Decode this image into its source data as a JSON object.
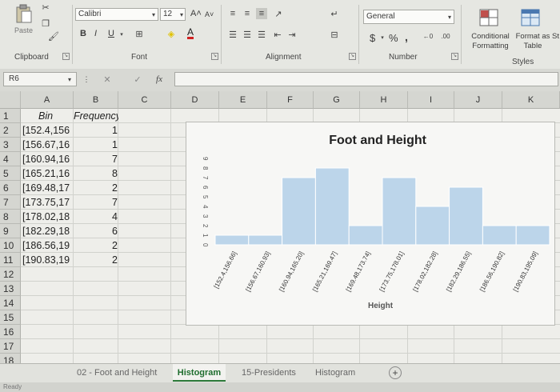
{
  "ribbon": {
    "paste_label": "Paste",
    "clipboard_label": "Clipboard",
    "font_label": "Font",
    "alignment_label": "Alignment",
    "number_label": "Number",
    "styles_label": "Styles",
    "font_name": "Calibri",
    "font_size": "12",
    "number_format": "General",
    "conditional_formatting": "Conditional Formatting",
    "format_as_table": "Format as Table",
    "cell_styles_partial": "St",
    "bold": "B",
    "italic": "I",
    "underline": "U",
    "currency": "$",
    "percent": "%",
    "comma": ",",
    "increase_font": "A˄",
    "decrease_font": "A˅",
    "font_color_letter": "A"
  },
  "formula_bar": {
    "name_box": "R6",
    "cancel": "✕",
    "enter": "✓",
    "fx": "fx",
    "formula": ""
  },
  "columns": [
    "A",
    "B",
    "C",
    "D",
    "E",
    "F",
    "G",
    "H",
    "I",
    "J",
    "K"
  ],
  "rows": [
    "1",
    "2",
    "3",
    "4",
    "5",
    "6",
    "7",
    "8",
    "9",
    "10",
    "11",
    "12",
    "13",
    "14",
    "15",
    "16",
    "17",
    "18"
  ],
  "table": {
    "header_bin": "Bin",
    "header_frequency": "Frequency",
    "bins": [
      "[152.4,156",
      "[156.67,16",
      "[160.94,16",
      "[165.21,16",
      "[169.48,17",
      "[173.75,17",
      "[178.02,18",
      "[182.29,18",
      "[186.56,19",
      "[190.83,19"
    ],
    "frequencies": [
      "1",
      "1",
      "7",
      "8",
      "2",
      "7",
      "4",
      "6",
      "2",
      "2"
    ]
  },
  "chart_data": {
    "type": "bar",
    "title": "Foot and Height",
    "xlabel": "Height",
    "ylabel": "",
    "categories": [
      "[152.4,156.66]",
      "[156.67,160.93]",
      "[160.94,165.20]",
      "[165.21,169.47]",
      "[169.48,173.74]",
      "[173.75,178.01]",
      "[178.02,182.28]",
      "[182.29,186.55]",
      "[186.56,190.82]",
      "[190.83,195.09]"
    ],
    "values": [
      1,
      1,
      7,
      8,
      2,
      7,
      4,
      6,
      2,
      2
    ],
    "ylim": [
      0,
      9
    ],
    "yticks": [
      "0",
      "1",
      "2",
      "3",
      "4",
      "5",
      "6",
      "7",
      "8",
      "9"
    ],
    "grid": false,
    "legend": "none",
    "bar_color": "#bcd5ea",
    "bar_edge": "#ffffff"
  },
  "tabs": {
    "items": [
      "02 - Foot and Height",
      "Histogram",
      "15-Presidents",
      "Histogram"
    ],
    "active_index": 1,
    "add_sheet": "+"
  },
  "status": {
    "text": "Ready"
  }
}
